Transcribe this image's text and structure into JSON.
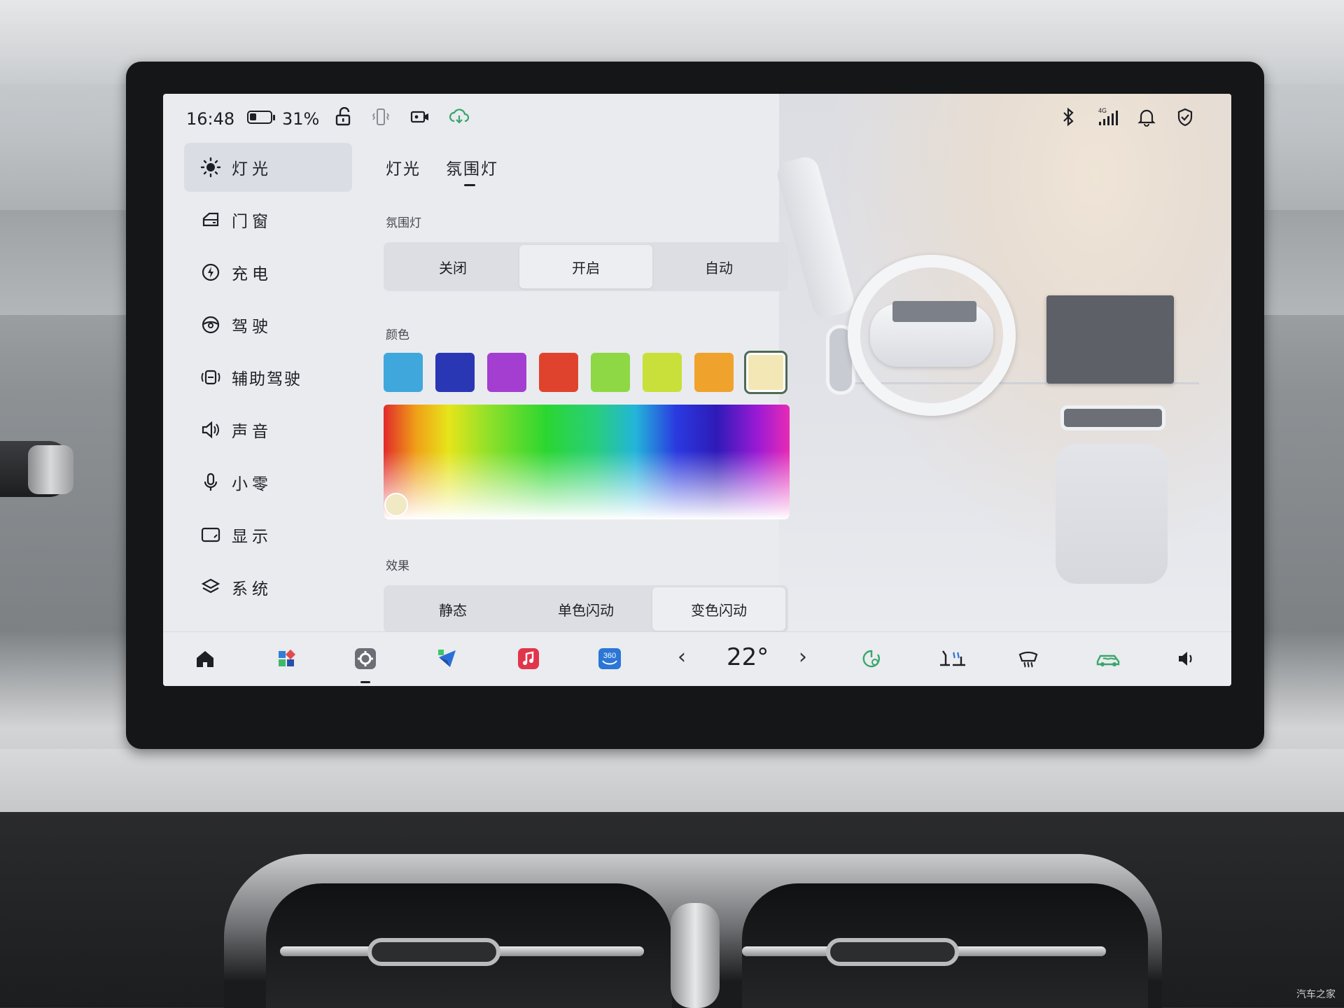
{
  "status_bar": {
    "time": "16:48",
    "battery_percent": "31%",
    "battery_level": 0.31,
    "icons": [
      "unlock-icon",
      "phone-vibrate-icon",
      "dashcam-icon",
      "cloud-download-icon",
      "bluetooth-icon",
      "signal-4g-icon",
      "bell-icon",
      "shield-check-icon"
    ],
    "signal_label": "4G"
  },
  "sidebar": {
    "items": [
      {
        "label": "灯光",
        "icon": "sun-icon",
        "active": true
      },
      {
        "label": "门窗",
        "icon": "door-icon",
        "active": false
      },
      {
        "label": "充电",
        "icon": "charge-icon",
        "active": false
      },
      {
        "label": "驾驶",
        "icon": "steering-wheel-icon",
        "active": false
      },
      {
        "label": "辅助驾驶",
        "icon": "assist-drive-icon",
        "active": false
      },
      {
        "label": "声音",
        "icon": "speaker-icon",
        "active": false
      },
      {
        "label": "小零",
        "icon": "microphone-icon",
        "active": false
      },
      {
        "label": "显示",
        "icon": "display-icon",
        "active": false
      },
      {
        "label": "系统",
        "icon": "layers-icon",
        "active": false
      }
    ]
  },
  "tabs": [
    {
      "label": "灯光",
      "active": false
    },
    {
      "label": "氛围灯",
      "active": true
    }
  ],
  "ambient": {
    "section_label": "氛围灯",
    "options": [
      "关闭",
      "开启",
      "自动"
    ],
    "selected": "开启"
  },
  "color": {
    "section_label": "颜色",
    "swatches": [
      "#3fa7dc",
      "#2a37b5",
      "#a43ed0",
      "#e0432d",
      "#8fd845",
      "#c9e03a",
      "#efa22c",
      "#f3e7b5"
    ],
    "selected_index": 7
  },
  "effect": {
    "section_label": "效果",
    "options": [
      "静态",
      "单色闪动",
      "变色闪动"
    ],
    "selected": "变色闪动"
  },
  "dock": {
    "icons": [
      "home-icon",
      "apps-icon",
      "settings-icon",
      "navigation-icon",
      "music-icon",
      "camera-360-icon",
      "fan-icon",
      "seat-heat-icon",
      "defrost-icon",
      "car-air-icon",
      "volume-icon"
    ],
    "camera_label": "360",
    "temperature": "22°",
    "chevron_left": "‹",
    "chevron_right": "›"
  },
  "watermark": "汽车之家"
}
